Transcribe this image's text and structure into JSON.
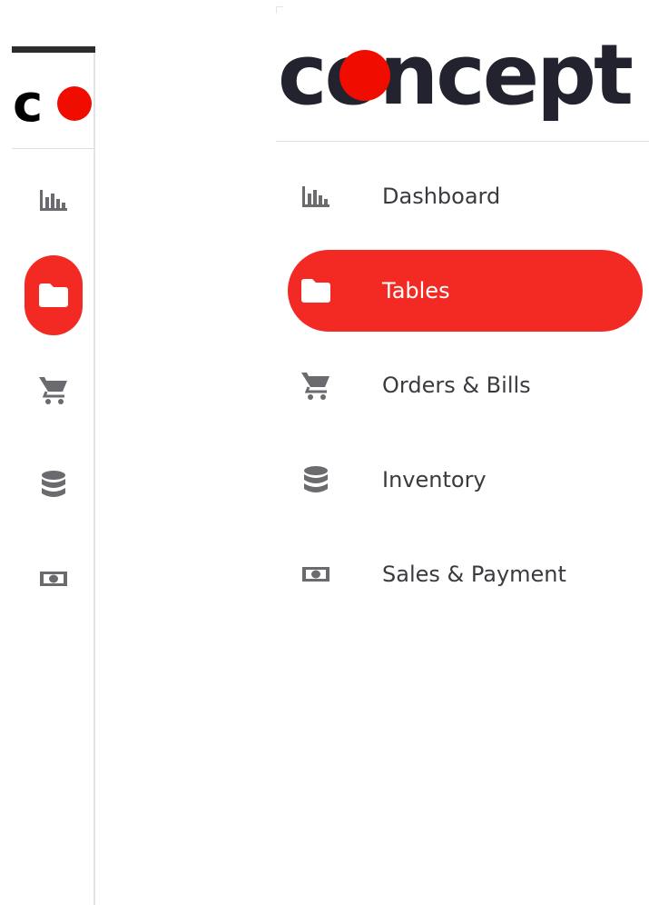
{
  "logo": {
    "text": "concept",
    "short_text": "c",
    "dot_color": "#f00d00"
  },
  "nav": {
    "items": [
      {
        "label": "Dashboard",
        "icon": "bar-chart-icon",
        "active": false
      },
      {
        "label": "Tables",
        "icon": "folder-icon",
        "active": true
      },
      {
        "label": "Orders & Bills",
        "icon": "shopping-cart-icon",
        "active": false
      },
      {
        "label": "Inventory",
        "icon": "database-icon",
        "active": false
      },
      {
        "label": "Sales & Payment",
        "icon": "cash-icon",
        "active": false
      }
    ]
  },
  "colors": {
    "accent": "#f32a24",
    "icon_gray": "#6b6b6f",
    "text": "#3b3b3f",
    "logo_dark": "#22232e"
  }
}
